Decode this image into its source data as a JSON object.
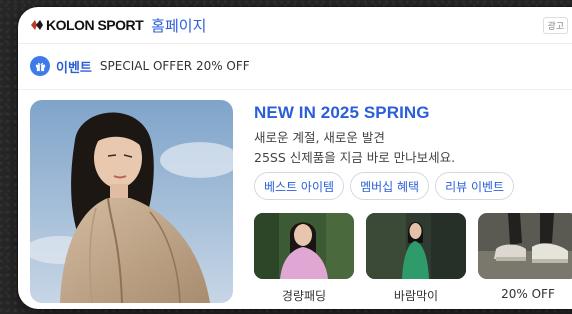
{
  "header": {
    "brand": "KOLON SPORT",
    "home_link": "홈페이지",
    "ad_badge": "광고"
  },
  "event": {
    "icon": "gift-icon",
    "tag": "이벤트",
    "text": "SPECIAL OFFER 20% OFF"
  },
  "main": {
    "headline": "NEW IN 2025 SPRING",
    "desc_line1": "새로운 계절, 새로운 발견",
    "desc_line2": "25SS 신제품을 지금 바로 만나보세요.",
    "chips": [
      "베스트 아이템",
      "멤버십 혜택",
      "리뷰 이벤트"
    ],
    "thumbs": [
      "경량패딩",
      "바람막이",
      "20% OFF"
    ]
  },
  "colors": {
    "accent": "#2b5fd9",
    "event_icon_bg": "#3e7be8"
  }
}
